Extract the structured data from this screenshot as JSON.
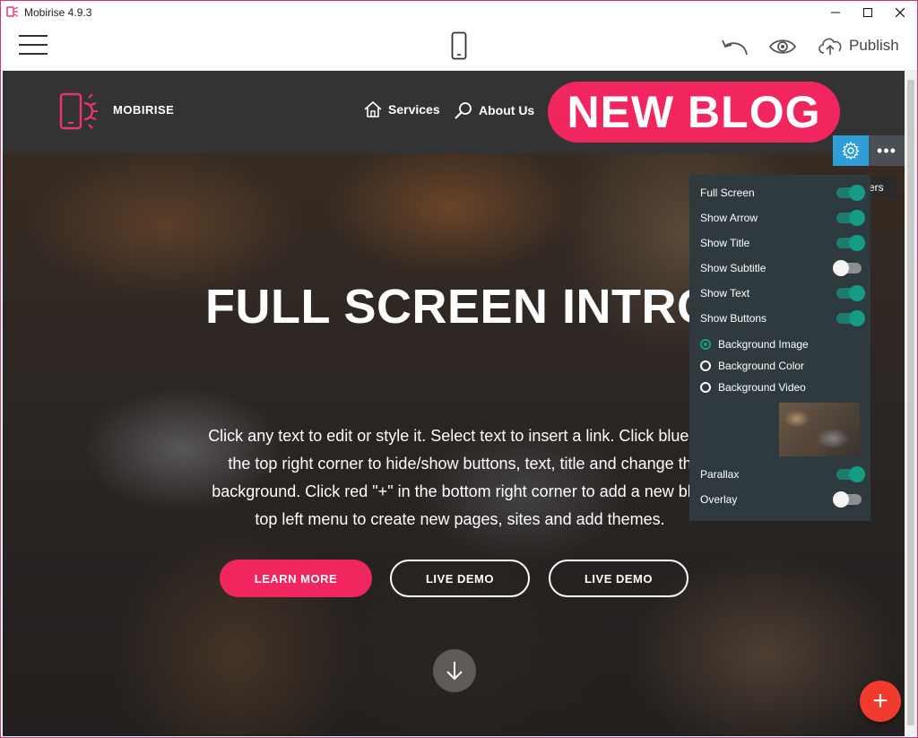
{
  "window": {
    "title": "Mobirise 4.9.3"
  },
  "toolbar": {
    "publish_label": "Publish"
  },
  "site_nav": {
    "brand": "MOBIRISE",
    "links": [
      {
        "label": "Services"
      },
      {
        "label": "About Us"
      }
    ],
    "cta": "NEW BLOG"
  },
  "hero": {
    "title": "FULL SCREEN INTRO",
    "text_lines": [
      "Click any text to edit or style it. Select text to insert a link. Click blue \"G",
      "the top right corner to hide/show buttons, text, title and change th",
      "background. Click red \"+\" in the bottom right corner to add a new bloc",
      "top left menu to create new pages, sites and add themes."
    ],
    "buttons": [
      "LEARN MORE",
      "LIVE DEMO",
      "LIVE DEMO"
    ]
  },
  "block_controls": {
    "more_label": "•••",
    "tooltip": "eters"
  },
  "parameters": {
    "toggles": [
      {
        "label": "Full Screen",
        "on": true
      },
      {
        "label": "Show Arrow",
        "on": true
      },
      {
        "label": "Show Title",
        "on": true
      },
      {
        "label": "Show Subtitle",
        "on": false
      },
      {
        "label": "Show Text",
        "on": true
      },
      {
        "label": "Show Buttons",
        "on": true
      }
    ],
    "background_options": [
      {
        "label": "Background Image",
        "checked": true
      },
      {
        "label": "Background Color",
        "checked": false
      },
      {
        "label": "Background Video",
        "checked": false
      }
    ],
    "extra_toggles": [
      {
        "label": "Parallax",
        "on": true
      },
      {
        "label": "Overlay",
        "on": false
      }
    ]
  },
  "fab": {
    "label": "+"
  },
  "colors": {
    "accent": "#f2265f",
    "gear_blue": "#2f9dd8",
    "toggle_on": "#149c86",
    "panel_bg": "#2e3a3e",
    "fab_red": "#f03b2e"
  }
}
